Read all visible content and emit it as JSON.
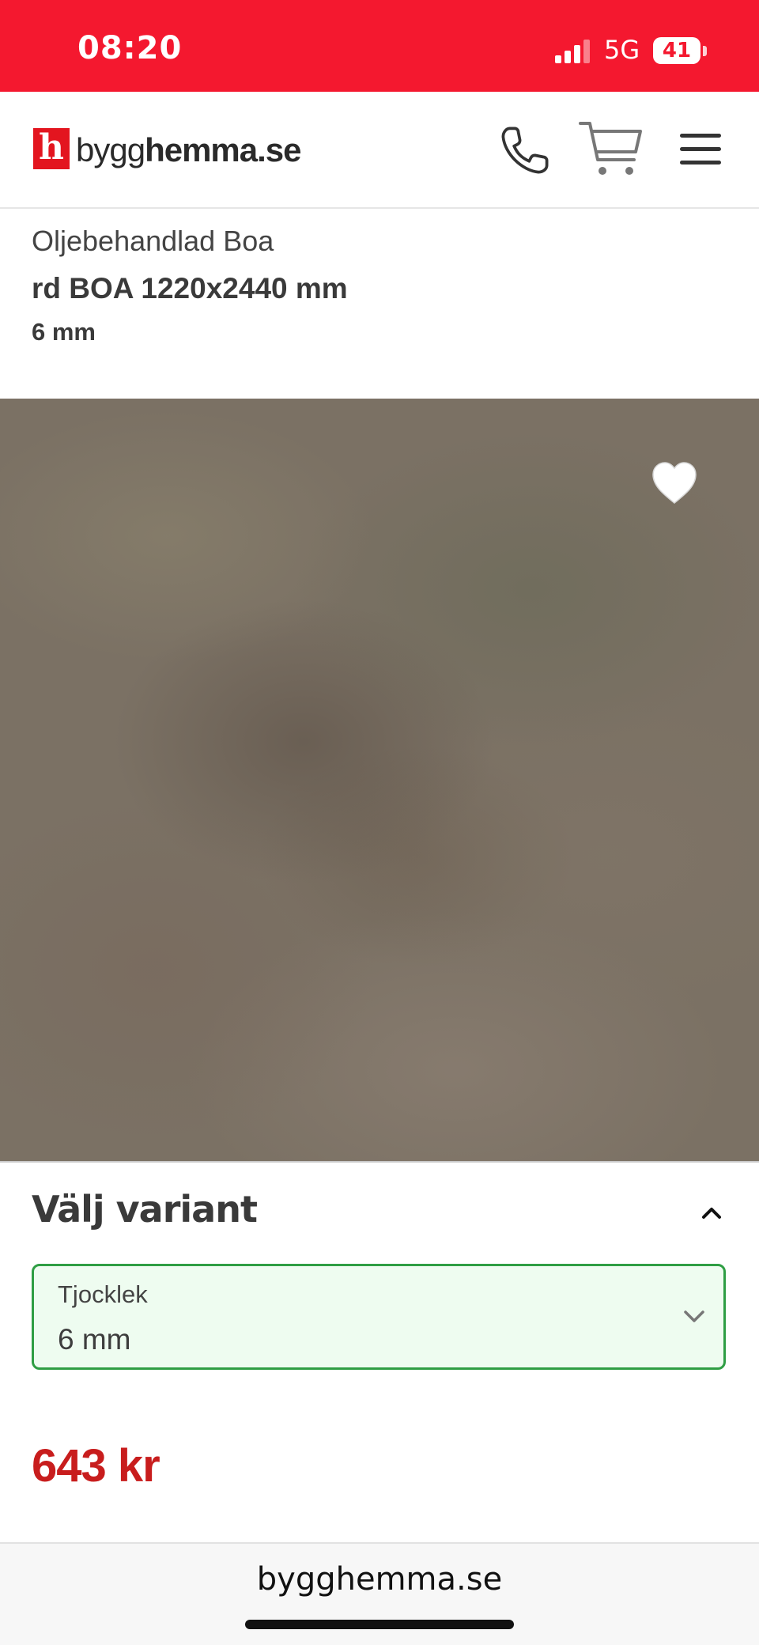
{
  "status_bar": {
    "time": "08:20",
    "network": "5G",
    "battery": "41",
    "background_color": "#f4182f"
  },
  "header": {
    "logo_mark": "h",
    "logo_text_regular": "bygg",
    "logo_text_bold": "hemma",
    "logo_text_suffix": ".se",
    "icons": [
      "phone-icon",
      "cart-icon",
      "menu-icon"
    ]
  },
  "product": {
    "brand": "Oljebehandlad Boa",
    "name": "rd BOA 1220x2440 mm",
    "variant": "6 mm",
    "favorite_icon": "heart-icon"
  },
  "variant_section": {
    "title": "Välj variant",
    "select_label": "Tjocklek",
    "select_value": "6 mm",
    "accent_color": "#2f9e44"
  },
  "price": {
    "value": "643 kr",
    "color": "#c81d1d"
  },
  "browser": {
    "url": "bygghemma.se"
  }
}
